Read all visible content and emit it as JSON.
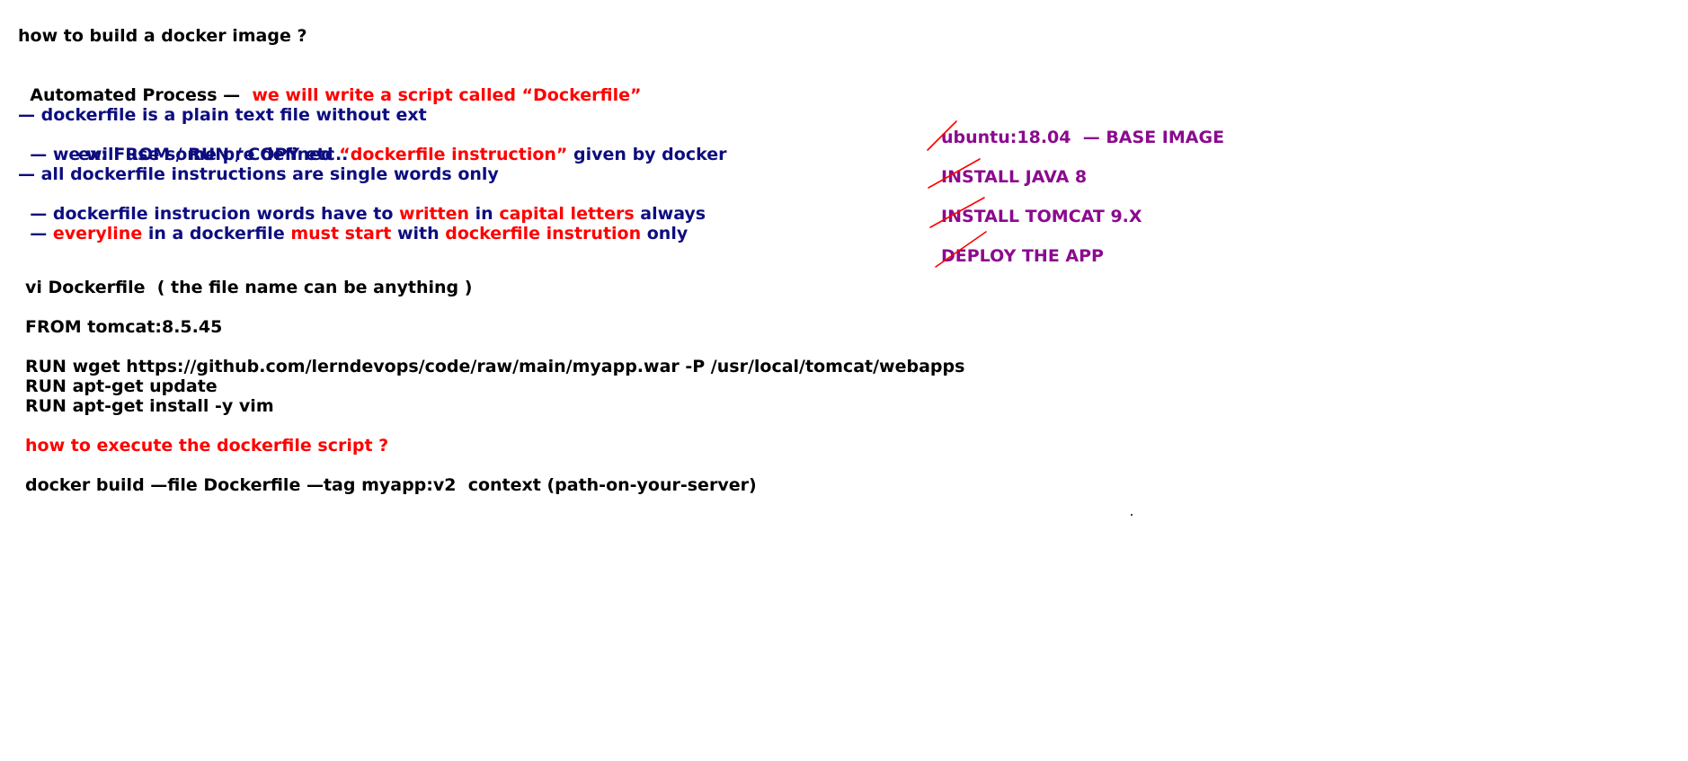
{
  "notes": {
    "title": "how to build a docker image ?",
    "automated_label": "Automated Process —  ",
    "automated_red": "we will write a script called “Dockerfile”",
    "bullets": {
      "b1": "— dockerfile is a plain text file without ext",
      "b2_a": "— we will use some pre defined ",
      "b2_b": "“dockerfile instruction”",
      "b2_c": " given by docker",
      "b2_example": "ex: FROM / RUN / COPY etc..",
      "b3": "— all dockerfile instructions are single words only",
      "b4_a": "— dockerfile instrucion words have to ",
      "b4_b": "written",
      "b4_c": " in ",
      "b4_d": "capital letters",
      "b4_e": " always",
      "b5_a": "— ",
      "b5_b": "everyline",
      "b5_c": " in a dockerfile ",
      "b5_d": "must start",
      "b5_e": " with ",
      "b5_f": "dockerfile instrution",
      "b5_g": " only"
    },
    "steps": [
      "ubuntu:18.04  — BASE IMAGE",
      "INSTALL JAVA 8",
      "INSTALL TOMCAT 9.X",
      "DEPLOY THE APP"
    ],
    "vi_line": "vi Dockerfile  ( the file name can be anything )",
    "from_line": "FROM tomcat:8.5.45",
    "run_lines": [
      "RUN wget https://github.com/lerndevops/code/raw/main/myapp.war -P /usr/local/tomcat/webapps",
      "RUN apt-get update",
      "RUN apt-get install -y vim"
    ],
    "execute_question": "how to execute the dockerfile script ?",
    "build_command": "docker build —file Dockerfile —tag myapp:v2  context (path-on-your-server)"
  },
  "colors": {
    "text": "#000000",
    "navy": "#0d0d80",
    "red": "#ff0000",
    "purple": "#8b0a8f",
    "strike": "#ff0000"
  }
}
